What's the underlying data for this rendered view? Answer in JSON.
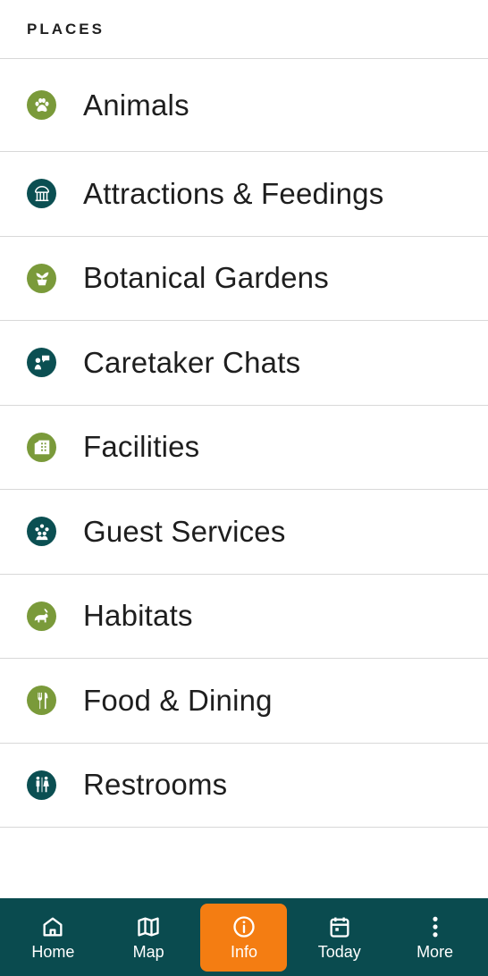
{
  "header": {
    "title": "PLACES"
  },
  "places": [
    {
      "label": "Animals",
      "icon": "paw-icon",
      "color": "green"
    },
    {
      "label": "Attractions & Feedings",
      "icon": "gazebo-icon",
      "color": "teal"
    },
    {
      "label": "Botanical Gardens",
      "icon": "plant-pot-icon",
      "color": "green"
    },
    {
      "label": "Caretaker Chats",
      "icon": "speaker-chat-icon",
      "color": "teal"
    },
    {
      "label": "Facilities",
      "icon": "building-icon",
      "color": "green"
    },
    {
      "label": "Guest Services",
      "icon": "people-group-icon",
      "color": "teal"
    },
    {
      "label": "Habitats",
      "icon": "habitat-animal-icon",
      "color": "green"
    },
    {
      "label": "Food & Dining",
      "icon": "fork-knife-icon",
      "color": "green"
    },
    {
      "label": "Restrooms",
      "icon": "restroom-icon",
      "color": "teal"
    }
  ],
  "tabbar": {
    "items": [
      {
        "label": "Home",
        "icon": "home-icon",
        "active": false
      },
      {
        "label": "Map",
        "icon": "map-icon",
        "active": false
      },
      {
        "label": "Info",
        "icon": "info-icon",
        "active": true
      },
      {
        "label": "Today",
        "icon": "calendar-icon",
        "active": false
      },
      {
        "label": "More",
        "icon": "more-vertical-icon",
        "active": false
      }
    ]
  },
  "colors": {
    "green": "#7a9a3a",
    "teal": "#0b4f52",
    "tabbar": "#0a4b4f",
    "active_tab": "#f47d12"
  }
}
